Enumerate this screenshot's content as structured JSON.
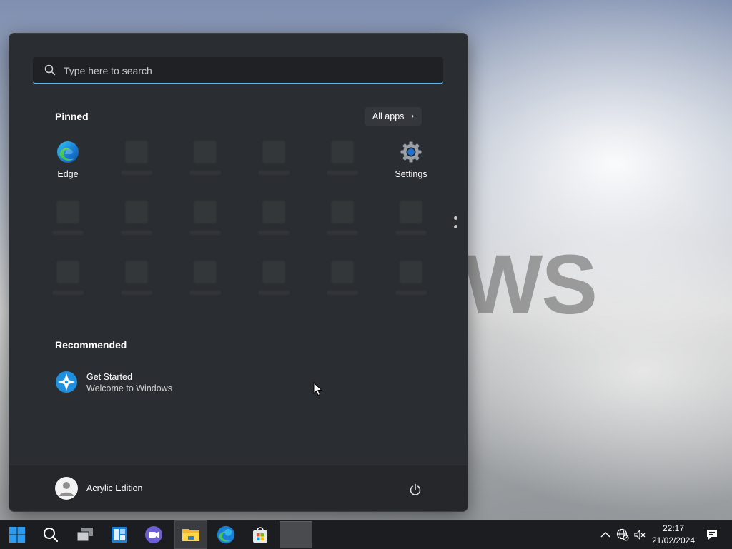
{
  "desktop": {
    "wallpaper_text": "WS"
  },
  "start_menu": {
    "search": {
      "placeholder": "Type here to search"
    },
    "pinned": {
      "title": "Pinned",
      "all_apps_label": "All apps",
      "apps": [
        {
          "label": "Edge",
          "icon": "edge-icon"
        },
        {
          "label": "Settings",
          "icon": "settings-gear-icon"
        }
      ]
    },
    "recommended": {
      "title": "Recommended",
      "items": [
        {
          "title": "Get Started",
          "subtitle": "Welcome to Windows",
          "icon": "get-started-icon"
        }
      ]
    },
    "user": {
      "name": "Acrylic Edition"
    }
  },
  "taskbar": {
    "apps": [
      "start-windows-icon",
      "search-icon",
      "task-view-icon",
      "widgets-icon",
      "teams-chat-icon",
      "file-explorer-icon",
      "edge-icon",
      "microsoft-store-icon"
    ],
    "clock": {
      "time": "22:17",
      "date": "21/02/2024"
    }
  },
  "colors": {
    "accent": "#5cb8f0",
    "menu_bg": "#2a2d31",
    "taskbar_bg": "#1c1d20"
  }
}
